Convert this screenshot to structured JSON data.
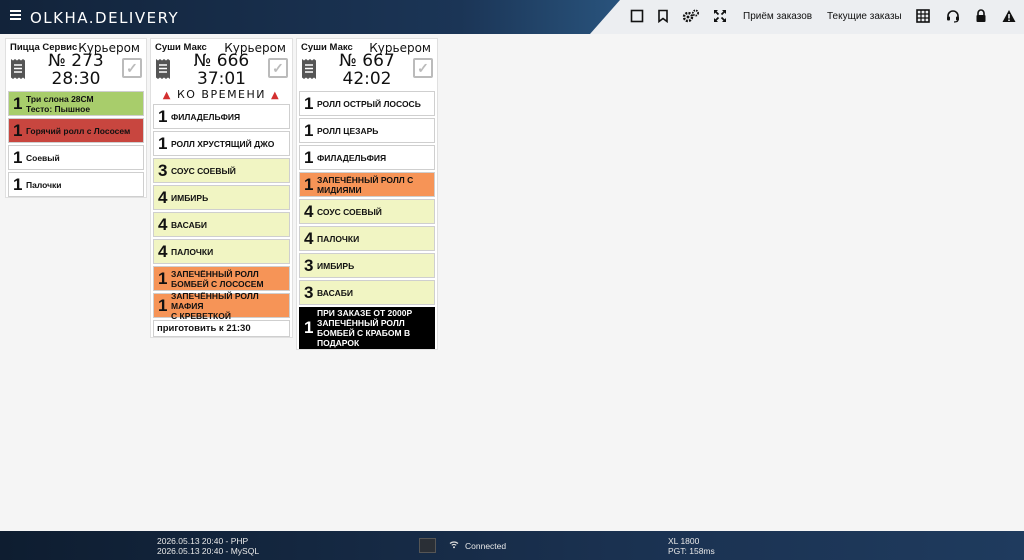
{
  "app": {
    "logo": "OLKHA.DELIVERY"
  },
  "topbar": {
    "icons": [
      "square-icon",
      "bookmark-icon",
      "gears-icon",
      "expand-icon"
    ],
    "links": [
      "Приём заказов",
      "Текущие заказы"
    ],
    "right_icons": [
      "grid-icon",
      "headset-icon",
      "lock-icon",
      "warning-icon"
    ]
  },
  "orders": [
    {
      "shop": "Пицца Сервис",
      "courier": "Курьером",
      "number": "№ 273",
      "time": "28:30",
      "items": [
        {
          "qty": "1",
          "name": "Три слона 28СМ\nТесто: Пышное",
          "color": "green"
        },
        {
          "qty": "1",
          "name": "Горячий ролл с Лососем",
          "color": "red"
        },
        {
          "qty": "1",
          "name": "Соевый",
          "color": "white"
        },
        {
          "qty": "1",
          "name": "Палочки",
          "color": "white"
        }
      ]
    },
    {
      "shop": "Суши Макс",
      "courier": "Курьером",
      "number": "№ 666",
      "time": "37:01",
      "timed_label": "КО ВРЕМЕНИ",
      "items": [
        {
          "qty": "1",
          "name": "ФИЛАДЕЛЬФИЯ",
          "color": "white"
        },
        {
          "qty": "1",
          "name": "РОЛЛ ХРУСТЯЩИЙ ДЖО",
          "color": "white"
        },
        {
          "qty": "3",
          "name": "СОУС СОЕВЫЙ",
          "color": "yellow"
        },
        {
          "qty": "4",
          "name": "ИМБИРЬ",
          "color": "yellow"
        },
        {
          "qty": "4",
          "name": "ВАСАБИ",
          "color": "yellow"
        },
        {
          "qty": "4",
          "name": "ПАЛОЧКИ",
          "color": "yellow"
        },
        {
          "qty": "1",
          "name": "ЗАПЕЧЁННЫЙ РОЛЛ\nБОМБЕЙ С ЛОСОСЕМ",
          "color": "orange"
        },
        {
          "qty": "1",
          "name": "ЗАПЕЧЁННЫЙ РОЛЛ МАФИЯ\nС КРЕВЕТКОЙ",
          "color": "orange"
        }
      ],
      "note": "приготовить к 21:30"
    },
    {
      "shop": "Суши Макс",
      "courier": "Курьером",
      "number": "№ 667",
      "time": "42:02",
      "items": [
        {
          "qty": "1",
          "name": "РОЛЛ ОСТРЫЙ ЛОСОСЬ",
          "color": "white"
        },
        {
          "qty": "1",
          "name": "РОЛЛ ЦЕЗАРЬ",
          "color": "white"
        },
        {
          "qty": "1",
          "name": "ФИЛАДЕЛЬФИЯ",
          "color": "white"
        },
        {
          "qty": "1",
          "name": "ЗАПЕЧЁННЫЙ РОЛЛ С\nМИДИЯМИ",
          "color": "orange"
        },
        {
          "qty": "4",
          "name": "СОУС СОЕВЫЙ",
          "color": "yellow"
        },
        {
          "qty": "4",
          "name": "ПАЛОЧКИ",
          "color": "yellow"
        },
        {
          "qty": "3",
          "name": "ИМБИРЬ",
          "color": "yellow"
        },
        {
          "qty": "3",
          "name": "ВАСАБИ",
          "color": "yellow"
        },
        {
          "qty": "1",
          "name": "ПРИ ЗАКАЗЕ ОТ 2000Р\nЗАПЕЧЁННЫЙ РОЛЛ\nБОМБЕЙ С КРАБОМ В\nПОДАРОК",
          "color": "black"
        }
      ]
    }
  ],
  "footer": {
    "php": "2026.05.13 20:40 - PHP",
    "mysql": "2026.05.13 20:40 - MySQL",
    "status": "Connected",
    "xl": "XL 1800",
    "pgt": "PGT: 158ms"
  },
  "colors": {
    "green": "#a8cd6b",
    "red": "#c8463f",
    "orange": "#f69457",
    "yellow": "#f1f5c3",
    "black": "#000000"
  }
}
